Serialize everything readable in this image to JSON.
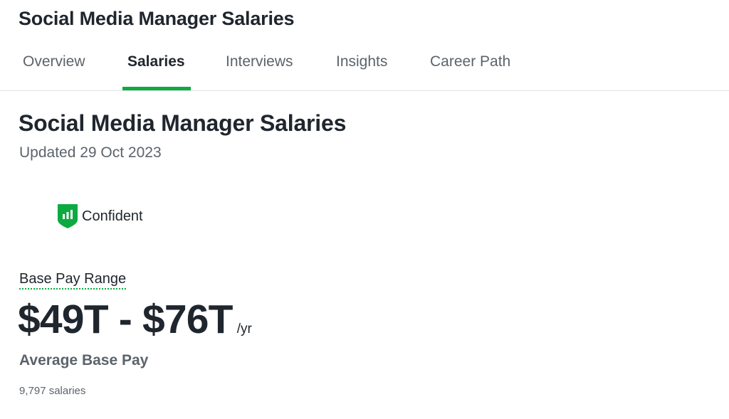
{
  "header": {
    "title": "Social Media Manager Salaries"
  },
  "tabs": [
    {
      "label": "Overview",
      "active": false
    },
    {
      "label": "Salaries",
      "active": true
    },
    {
      "label": "Interviews",
      "active": false
    },
    {
      "label": "Insights",
      "active": false
    },
    {
      "label": "Career Path",
      "active": false
    }
  ],
  "main": {
    "title": "Social Media Manager Salaries",
    "updated": "Updated 29 Oct 2023",
    "confidence": {
      "icon": "shield-bar-chart-icon",
      "label": "Confident"
    },
    "base_pay": {
      "label": "Base Pay Range",
      "range": "$49T - $76T",
      "unit": "/yr"
    },
    "average_label": "Average Base Pay",
    "salary_count": "9,797 salaries"
  },
  "colors": {
    "accent": "#0caa41",
    "text_primary": "#20262e",
    "text_secondary": "#5c636b",
    "divider": "#dfe1e4"
  }
}
